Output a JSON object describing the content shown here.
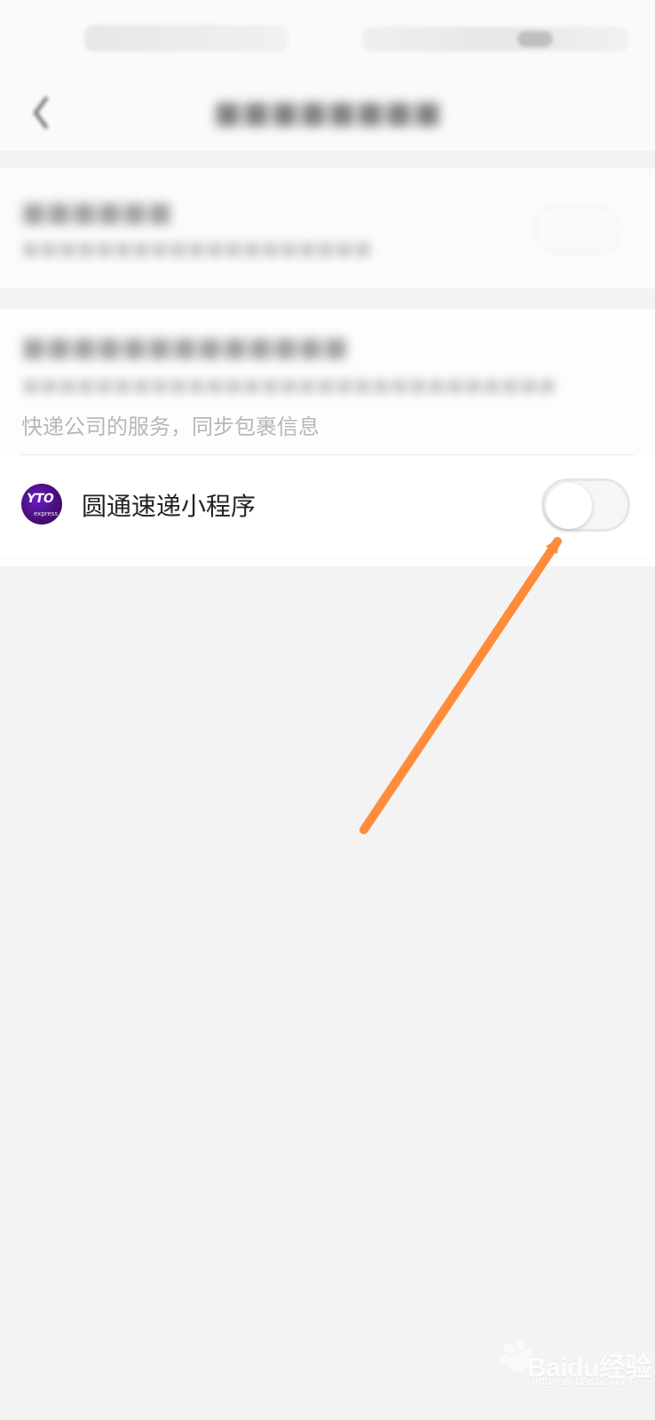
{
  "colors": {
    "arrow": "#ff8c3a",
    "page_bg": "#f3f3f3",
    "row_bg": "#ffffff",
    "header_bg": "#fafafa",
    "logo_purple": "#4a0f7a",
    "logo_pink": "#ff2aa6",
    "toggle_border": "#e6e6e6"
  },
  "icons": {
    "back": "back-chevron-icon",
    "logo": "yto-express-logo"
  },
  "section2": {
    "desc_visible": "快递公司的服务，同步包裹信息"
  },
  "mini_program": {
    "name": "圆通速递小程序",
    "logo_mark": "YTO",
    "logo_tag": "express",
    "toggle_on": false
  },
  "watermark": {
    "text": "Baidu经验",
    "domain": "jingyan.baidu.com"
  }
}
